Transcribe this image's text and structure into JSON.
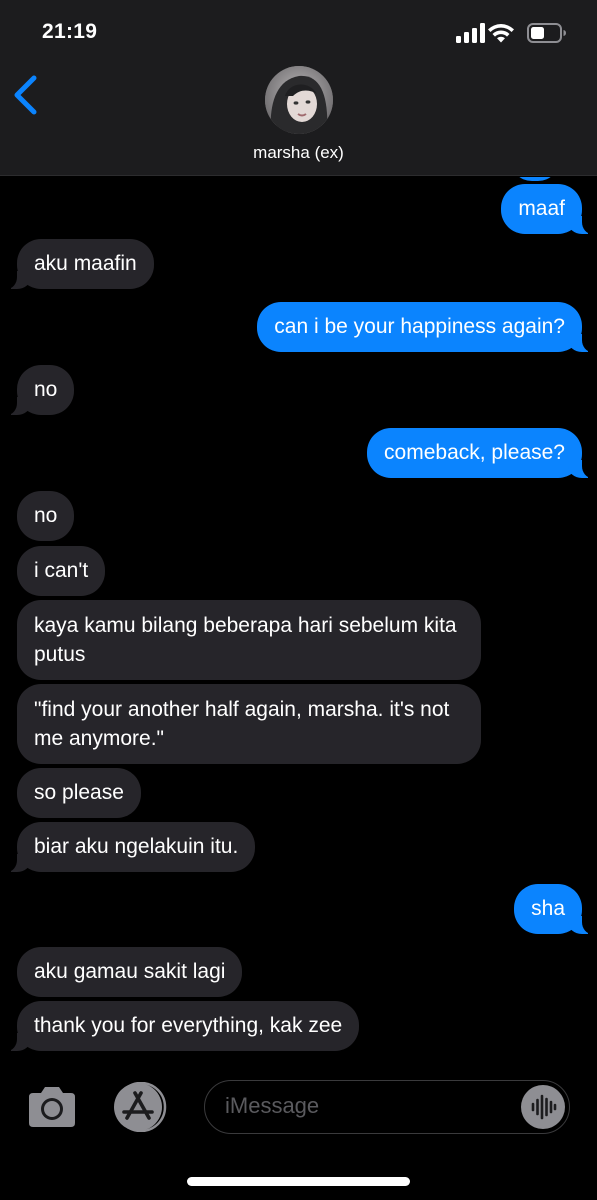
{
  "status_bar": {
    "time": "21:19"
  },
  "header": {
    "contact_name": "marsha (ex)",
    "back_icon": "chevron-left-icon",
    "accent_color": "#0b84fe"
  },
  "messages": [
    {
      "from": "me",
      "text": "maaf"
    },
    {
      "from": "them",
      "text": "aku maafin"
    },
    {
      "from": "me",
      "text": "can i be your happiness again?"
    },
    {
      "from": "them",
      "text": "no"
    },
    {
      "from": "me",
      "text": "comeback, please?"
    },
    {
      "from": "them",
      "text": "no"
    },
    {
      "from": "them",
      "text": "i can't"
    },
    {
      "from": "them",
      "text": "kaya kamu bilang beberapa hari sebelum kita putus"
    },
    {
      "from": "them",
      "text": "\"find your another half again, marsha. it's not me anymore.\""
    },
    {
      "from": "them",
      "text": "so please"
    },
    {
      "from": "them",
      "text": "biar aku ngelakuin itu."
    },
    {
      "from": "me",
      "text": "sha"
    },
    {
      "from": "them",
      "text": "aku gamau sakit lagi"
    },
    {
      "from": "them",
      "text": "thank you for everything, kak zee"
    }
  ],
  "input_bar": {
    "placeholder": "iMessage",
    "camera_icon": "camera-icon",
    "appstore_icon": "app-store-icon",
    "audio_icon": "audio-waveform-icon"
  },
  "colors": {
    "outgoing_bubble": "#0b84fe",
    "incoming_bubble": "#26252a",
    "background": "#000000",
    "header_background": "#1c1c1e"
  }
}
